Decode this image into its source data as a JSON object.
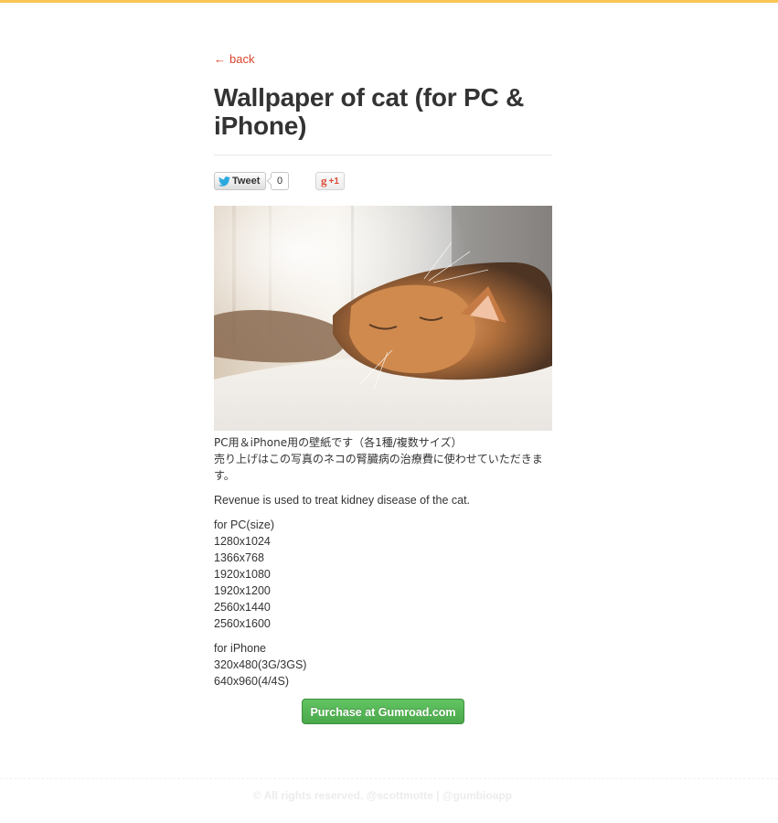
{
  "back_link": {
    "arrow": "←",
    "label": "back"
  },
  "title": "Wallpaper of cat (for PC & iPhone)",
  "social": {
    "tweet_label": "Tweet",
    "tweet_count": "0",
    "gplus_g": "g",
    "gplus_label": "+1"
  },
  "description": {
    "jp_line1": "PC用＆iPhone用の壁紙です（各1種/複数サイズ）",
    "jp_line2": "売り上げはこの写真のネコの腎臓病の治療費に使わせていただきます。",
    "en": "Revenue is used to treat kidney disease of the cat."
  },
  "pc_sizes": {
    "heading": "for PC(size)",
    "items": [
      "1280x1024",
      "1366x768",
      "1920x1080",
      "1920x1200",
      "2560x1440",
      "2560x1600"
    ]
  },
  "iphone_sizes": {
    "heading": "for iPhone",
    "items": [
      "320x480(3G/3GS)",
      "640x960(4/4S)"
    ]
  },
  "purchase_label": "Purchase at Gumroad.com",
  "footer": {
    "copyright": "© All rights reserved.",
    "author": "@scottmotte",
    "separator": "|",
    "app": "@gumbioapp"
  },
  "colors": {
    "top_bar": "#f9c555",
    "link": "#d9442b",
    "button_green": "#5cb85c"
  }
}
